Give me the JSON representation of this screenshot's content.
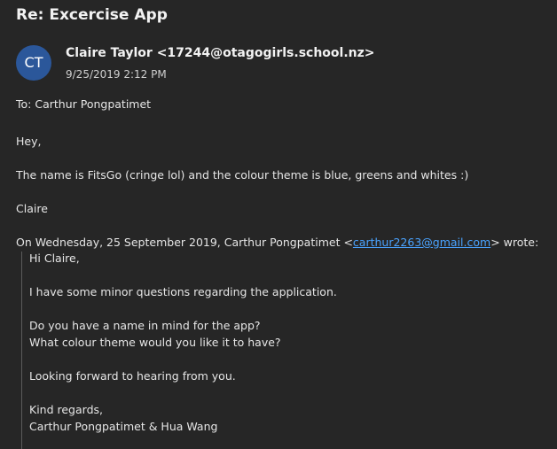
{
  "email": {
    "subject": "Re: Excercise App",
    "avatar_initials": "CT",
    "sender_name": "Claire Taylor",
    "sender_email": "<17244@otagogirls.school.nz>",
    "date": "9/25/2019 2:12 PM",
    "to_label": "To:",
    "to_value": "Carthur Pongpatimet",
    "body": {
      "greeting": "Hey,",
      "line1": "The name is FitsGo (cringe lol) and the colour theme is blue, greens and whites :)",
      "signoff": "Claire",
      "quote_header_prefix": "On Wednesday, 25 September 2019, Carthur Pongpatimet <",
      "quote_header_link": "carthur2263@gmail.com",
      "quote_header_suffix": "> wrote:"
    },
    "quoted": {
      "greeting": "Hi Claire,",
      "line1": "I have some minor questions regarding the application.",
      "line2": "Do you have a name in mind for the app?",
      "line3": "What colour theme would you like it to have?",
      "line4": "Looking forward to hearing from you.",
      "closing": "Kind regards,",
      "signature": "Carthur Pongpatimet & Hua Wang"
    }
  },
  "colors": {
    "background": "#262626",
    "avatar": "#2b579a",
    "link": "#4aa3ff"
  }
}
